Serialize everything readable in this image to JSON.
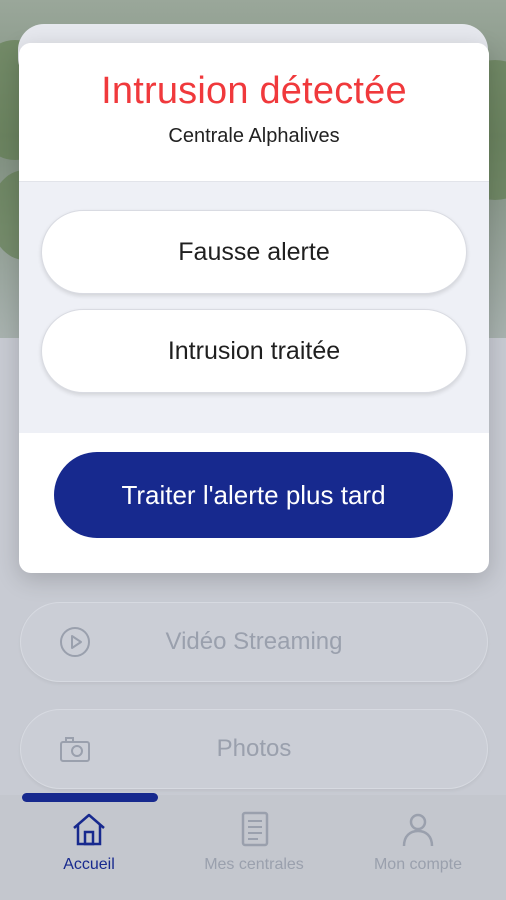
{
  "modal": {
    "title": "Intrusion détectée",
    "subtitle": "Centrale Alphalives",
    "options": [
      {
        "label": "Fausse alerte"
      },
      {
        "label": "Intrusion traitée"
      }
    ],
    "later_label": "Traiter l'alerte plus tard",
    "title_color": "#f0393c",
    "accent_color": "#17298e"
  },
  "menu": {
    "items": [
      {
        "label": "Vidéo Streaming",
        "icon": "play-circle-icon"
      },
      {
        "label": "Photos",
        "icon": "camera-icon"
      }
    ]
  },
  "tabs": [
    {
      "label": "Accueil",
      "icon": "home-icon",
      "active": true
    },
    {
      "label": "Mes centrales",
      "icon": "document-list-icon",
      "active": false
    },
    {
      "label": "Mon compte",
      "icon": "user-icon",
      "active": false
    }
  ]
}
